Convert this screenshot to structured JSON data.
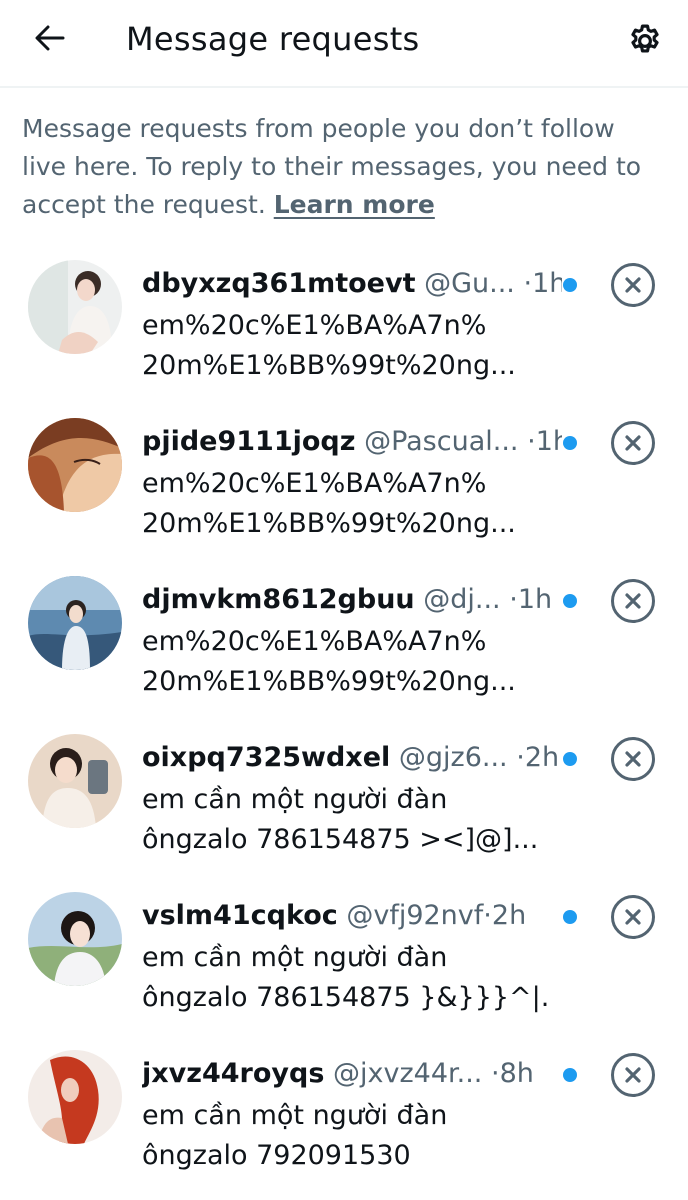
{
  "header": {
    "title": "Message requests",
    "back_icon": "arrow-left-icon",
    "settings_icon": "gear-icon"
  },
  "intro": {
    "text": "Message requests from people you don’t follow live here. To reply to their messages, you need to accept the request.",
    "link": "Learn more"
  },
  "colors": {
    "accent": "#1d9bf0",
    "secondary_text": "#536471",
    "primary_text": "#0f1419",
    "divider": "#eff3f4"
  },
  "requests": [
    {
      "name": "dbyxzq361mtoevt",
      "handle": "@Gu...",
      "dot": "·",
      "time": "1h",
      "preview_line1": "em%20c%E1%BA%A7n%",
      "preview_line2": "20m%E1%BB%99t%20ng...",
      "unread": true
    },
    {
      "name": "pjide9111joqz",
      "handle": "@Pascual...",
      "dot": "·",
      "time": "1h",
      "preview_line1": "em%20c%E1%BA%A7n%",
      "preview_line2": "20m%E1%BB%99t%20ng...",
      "unread": true
    },
    {
      "name": "djmvkm8612gbuu",
      "handle": "@dj...",
      "dot": "·",
      "time": "1h",
      "preview_line1": "em%20c%E1%BA%A7n%",
      "preview_line2": "20m%E1%BB%99t%20ng...",
      "unread": true
    },
    {
      "name": "oixpq7325wdxel",
      "handle": "@gjz6...",
      "dot": "·",
      "time": "2h",
      "preview_line1": "em cần một người đàn",
      "preview_line2": "ôngzalo 786154875 ><]@]...",
      "unread": true
    },
    {
      "name": "vslm41cqkoc",
      "handle": "@vfj92nvf",
      "dot": "·",
      "time": "2h",
      "preview_line1": "em cần một người đàn",
      "preview_line2": "ôngzalo 786154875 }&}}}^|...",
      "unread": true
    },
    {
      "name": "jxvz44royqs",
      "handle": "@jxvz44r...",
      "dot": "·",
      "time": "8h",
      "preview_line1": "em cần một người đàn",
      "preview_line2": "ôngzalo 792091530",
      "unread": true
    }
  ]
}
